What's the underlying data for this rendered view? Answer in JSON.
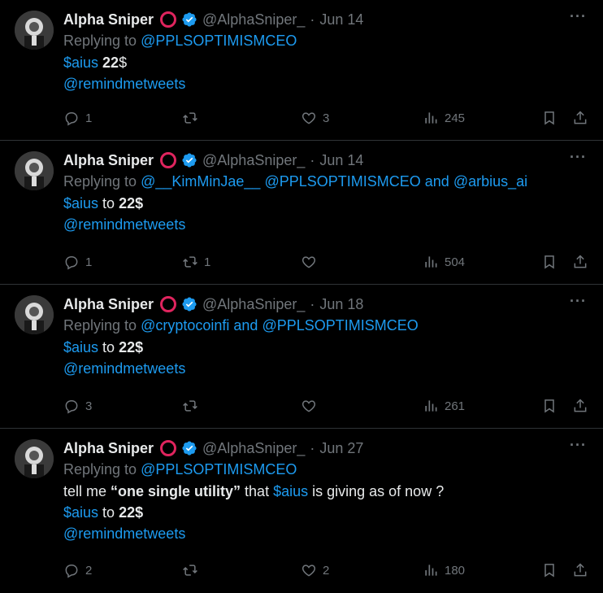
{
  "colors": {
    "accent": "#1d9bf0",
    "muted": "#71767b",
    "text": "#e7e9ea",
    "verified": "#1d9bf0",
    "emoji_circle": "#e0245e"
  },
  "tweets": [
    {
      "name": "Alpha Sniper",
      "handle": "@AlphaSniper_",
      "sep": "·",
      "date": "Jun 14",
      "replying_prefix": "Replying to",
      "replying_to": [
        "@PPLSOPTIMISMCEO"
      ],
      "replying_conj": "",
      "lines": [
        {
          "type": "price1",
          "a": "$aius",
          "b": "22",
          "c": "$"
        },
        {
          "type": "mention",
          "text": "@remindmetweets"
        }
      ],
      "replies": "1",
      "retweets": "",
      "likes": "3",
      "views": "245"
    },
    {
      "name": "Alpha Sniper",
      "handle": "@AlphaSniper_",
      "sep": "·",
      "date": "Jun 14",
      "replying_prefix": "Replying to",
      "replying_to": [
        "@__KimMinJae__",
        "@PPLSOPTIMISMCEO",
        "@arbius_ai"
      ],
      "replying_conj": "and",
      "lines": [
        {
          "type": "price2",
          "a": "$aius",
          "b": "to",
          "c": "22$"
        },
        {
          "type": "mention",
          "text": "@remindmetweets"
        }
      ],
      "replies": "1",
      "retweets": "1",
      "likes": "",
      "views": "504"
    },
    {
      "name": "Alpha Sniper",
      "handle": "@AlphaSniper_",
      "sep": "·",
      "date": "Jun 18",
      "replying_prefix": "Replying to",
      "replying_to": [
        "@cryptocoinfi",
        "@PPLSOPTIMISMCEO"
      ],
      "replying_conj": "and",
      "lines": [
        {
          "type": "price2",
          "a": "$aius",
          "b": "to",
          "c": "22$"
        },
        {
          "type": "mention",
          "text": "@remindmetweets"
        }
      ],
      "replies": "3",
      "retweets": "",
      "likes": "",
      "views": "261"
    },
    {
      "name": "Alpha Sniper",
      "handle": "@AlphaSniper_",
      "sep": "·",
      "date": "Jun 27",
      "replying_prefix": "Replying to",
      "replying_to": [
        "@PPLSOPTIMISMCEO"
      ],
      "replying_conj": "",
      "lines": [
        {
          "type": "utility",
          "pre": "tell me ",
          "quote": "“one single utility”",
          "mid": " that ",
          "cashtag": "$aius",
          "post": " is giving as of now ?"
        },
        {
          "type": "price2",
          "a": "$aius",
          "b": "to",
          "c": "22$"
        },
        {
          "type": "mention",
          "text": "@remindmetweets"
        }
      ],
      "replies": "2",
      "retweets": "",
      "likes": "2",
      "views": "180"
    }
  ],
  "icons": {
    "more": "more-icon",
    "reply": "reply-icon",
    "retweet": "retweet-icon",
    "like": "heart-icon",
    "views": "views-icon",
    "bookmark": "bookmark-icon",
    "share": "share-icon",
    "verified": "verified-badge-icon"
  }
}
